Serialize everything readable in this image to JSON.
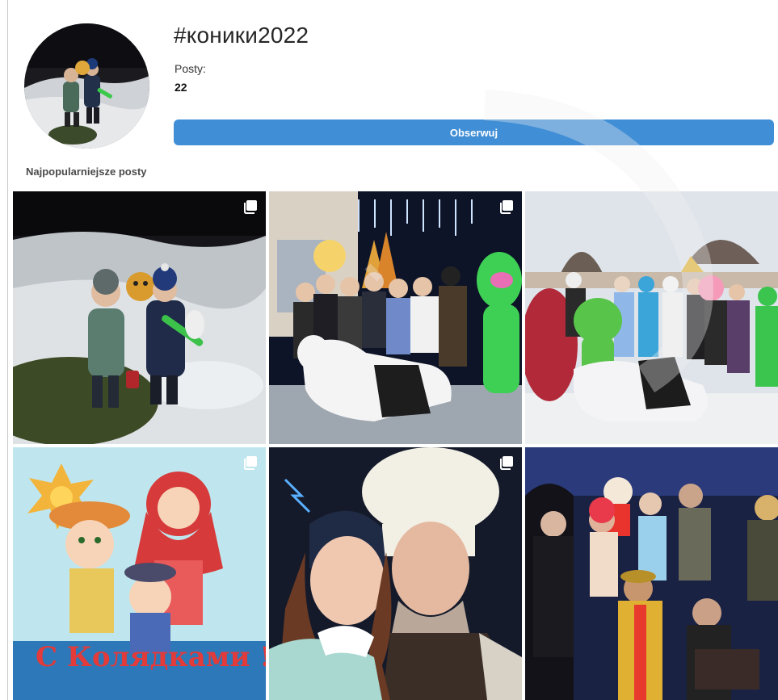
{
  "hashtag": {
    "title": "#коники2022",
    "posts_label": "Posty:",
    "posts_count": "22",
    "follow_label": "Obserwuj"
  },
  "section": {
    "title": "Najpopularniejsze posty"
  },
  "posts": [
    {
      "scene": "two children with toy horse mask in snow at night",
      "multi_photo": true
    },
    {
      "scene": "group of carolers in costumes by lit christmas tree",
      "multi_photo": true
    },
    {
      "scene": "crowd of costumed carolers with green creature and horse",
      "multi_photo": false
    },
    {
      "scene": "christmas carol greeting card illustration",
      "multi_photo": true,
      "card_text": "С Колядками !"
    },
    {
      "scene": "selfie of young woman and man in fur hat",
      "multi_photo": true
    },
    {
      "scene": "costumed performers on stage",
      "multi_photo": false
    }
  ],
  "colors": {
    "accent": "#3f8ed6",
    "background": "#ffffff"
  },
  "icons": {
    "multi": "carousel-icon"
  }
}
